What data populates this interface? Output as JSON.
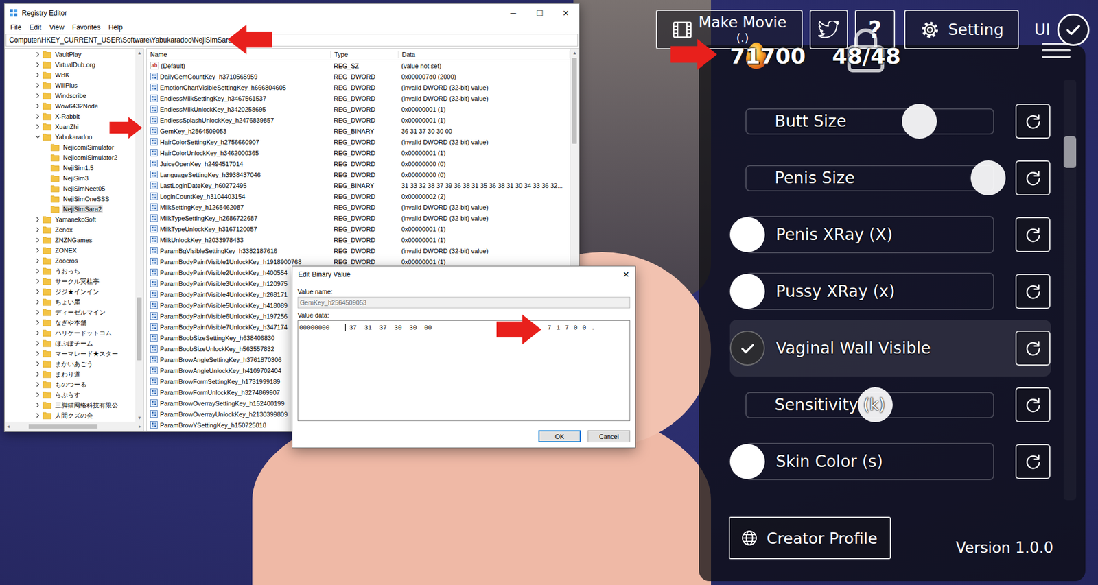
{
  "registry": {
    "title": "Registry Editor",
    "window_controls": [
      "─",
      "☐",
      "✕"
    ],
    "menu": [
      "File",
      "Edit",
      "View",
      "Favorites",
      "Help"
    ],
    "address": "Computer\\HKEY_CURRENT_USER\\Software\\Yabukaradoo\\NejiSimSara2",
    "tree": [
      {
        "label": "VaultPlay",
        "child": false,
        "expanded": false,
        "selected": false
      },
      {
        "label": "VirtualDub.org",
        "child": false,
        "expanded": false,
        "selected": false
      },
      {
        "label": "WBK",
        "child": false,
        "expanded": false,
        "selected": false
      },
      {
        "label": "WillPlus",
        "child": false,
        "expanded": false,
        "selected": false
      },
      {
        "label": "Windscribe",
        "child": false,
        "expanded": false,
        "selected": false
      },
      {
        "label": "Wow6432Node",
        "child": false,
        "expanded": false,
        "selected": false
      },
      {
        "label": "X-Rabbit",
        "child": false,
        "expanded": false,
        "selected": false
      },
      {
        "label": "XuanZhi",
        "child": false,
        "expanded": false,
        "selected": false
      },
      {
        "label": "Yabukaradoo",
        "child": false,
        "expanded": true,
        "selected": false
      },
      {
        "label": "NejicomiSimulator",
        "child": true,
        "expanded": false,
        "selected": false
      },
      {
        "label": "NejicomiSimulator2",
        "child": true,
        "expanded": false,
        "selected": false
      },
      {
        "label": "NejiSim1.5",
        "child": true,
        "expanded": false,
        "selected": false
      },
      {
        "label": "NejiSim3",
        "child": true,
        "expanded": false,
        "selected": false
      },
      {
        "label": "NejiSimNeet05",
        "child": true,
        "expanded": false,
        "selected": false
      },
      {
        "label": "NejiSimOneSSS",
        "child": true,
        "expanded": false,
        "selected": false
      },
      {
        "label": "NejiSimSara2",
        "child": true,
        "expanded": false,
        "selected": true
      },
      {
        "label": "YamanekoSoft",
        "child": false,
        "expanded": false,
        "selected": false
      },
      {
        "label": "Zenox",
        "child": false,
        "expanded": false,
        "selected": false
      },
      {
        "label": "ZNZNGames",
        "child": false,
        "expanded": false,
        "selected": false
      },
      {
        "label": "ZONEX",
        "child": false,
        "expanded": false,
        "selected": false
      },
      {
        "label": "Zoocros",
        "child": false,
        "expanded": false,
        "selected": false
      },
      {
        "label": "うおっち",
        "child": false,
        "expanded": false,
        "selected": false
      },
      {
        "label": "サークル冥柱亭",
        "child": false,
        "expanded": false,
        "selected": false
      },
      {
        "label": "ジジ★インイン",
        "child": false,
        "expanded": false,
        "selected": false
      },
      {
        "label": "ちょい屋",
        "child": false,
        "expanded": false,
        "selected": false
      },
      {
        "label": "ディーゼルマイン",
        "child": false,
        "expanded": false,
        "selected": false
      },
      {
        "label": "なぎや本舗",
        "child": false,
        "expanded": false,
        "selected": false
      },
      {
        "label": "ハリケードットコム",
        "child": false,
        "expanded": false,
        "selected": false
      },
      {
        "label": "ほぷぽチーム",
        "child": false,
        "expanded": false,
        "selected": false
      },
      {
        "label": "マーマレード★スター",
        "child": false,
        "expanded": false,
        "selected": false
      },
      {
        "label": "まかいあごう",
        "child": false,
        "expanded": false,
        "selected": false
      },
      {
        "label": "まわり道",
        "child": false,
        "expanded": false,
        "selected": false
      },
      {
        "label": "ものつーる",
        "child": false,
        "expanded": false,
        "selected": false
      },
      {
        "label": "らぷらす",
        "child": false,
        "expanded": false,
        "selected": false
      },
      {
        "label": "三脚猫网络科技有限公",
        "child": false,
        "expanded": false,
        "selected": false
      },
      {
        "label": "人間クズの会",
        "child": false,
        "expanded": false,
        "selected": false
      }
    ],
    "columns": [
      "Name",
      "Type",
      "Data"
    ],
    "string_icon_text": "ab",
    "rows": [
      {
        "kind": "string",
        "name": "(Default)",
        "type": "REG_SZ",
        "data": "(value not set)"
      },
      {
        "kind": "binary",
        "name": "DailyGemCountKey_h3710565959",
        "type": "REG_DWORD",
        "data": "0x000007d0 (2000)"
      },
      {
        "kind": "binary",
        "name": "EmotionChartVisibleSettingKey_h666804605",
        "type": "REG_DWORD",
        "data": "(invalid DWORD (32-bit) value)"
      },
      {
        "kind": "binary",
        "name": "EndlessMilkSettingKey_h3467561537",
        "type": "REG_DWORD",
        "data": "(invalid DWORD (32-bit) value)"
      },
      {
        "kind": "binary",
        "name": "EndlessMilkUnlockKey_h3420258695",
        "type": "REG_DWORD",
        "data": "0x00000001 (1)"
      },
      {
        "kind": "binary",
        "name": "EndlessSplashUnlockKey_h2476839857",
        "type": "REG_DWORD",
        "data": "0x00000001 (1)"
      },
      {
        "kind": "binary",
        "name": "GemKey_h2564509053",
        "type": "REG_BINARY",
        "data": "36 31 37 30 30 00"
      },
      {
        "kind": "binary",
        "name": "HairColorSettingKey_h2756660907",
        "type": "REG_DWORD",
        "data": "(invalid DWORD (32-bit) value)"
      },
      {
        "kind": "binary",
        "name": "HairColorUnlockKey_h3462000365",
        "type": "REG_DWORD",
        "data": "0x00000001 (1)"
      },
      {
        "kind": "binary",
        "name": "JuiceOpenKey_h2494517014",
        "type": "REG_DWORD",
        "data": "0x00000000 (0)"
      },
      {
        "kind": "binary",
        "name": "LanguageSettingKey_h3938437046",
        "type": "REG_DWORD",
        "data": "0x00000000 (0)"
      },
      {
        "kind": "binary",
        "name": "LastLoginDateKey_h60272495",
        "type": "REG_BINARY",
        "data": "31 33 32 38 37 39 36 38 31 35 36 38 31 30 34 33 36 32..."
      },
      {
        "kind": "binary",
        "name": "LoginCountKey_h3104403154",
        "type": "REG_DWORD",
        "data": "0x00000002 (2)"
      },
      {
        "kind": "binary",
        "name": "MilkSettingKey_h1265462087",
        "type": "REG_DWORD",
        "data": "(invalid DWORD (32-bit) value)"
      },
      {
        "kind": "binary",
        "name": "MilkTypeSettingKey_h2686722687",
        "type": "REG_DWORD",
        "data": "(invalid DWORD (32-bit) value)"
      },
      {
        "kind": "binary",
        "name": "MilkTypeUnlockKey_h3167120057",
        "type": "REG_DWORD",
        "data": "0x00000001 (1)"
      },
      {
        "kind": "binary",
        "name": "MilkUnlockKey_h2033978433",
        "type": "REG_DWORD",
        "data": "0x00000001 (1)"
      },
      {
        "kind": "binary",
        "name": "ParamBgVisibleSettingKey_h3382187616",
        "type": "REG_DWORD",
        "data": "(invalid DWORD (32-bit) value)"
      },
      {
        "kind": "binary",
        "name": "ParamBodyPaintVisible1UnlockKey_h1918900768",
        "type": "REG_DWORD",
        "data": "0x00000001 (1)"
      },
      {
        "kind": "binary",
        "name": "ParamBodyPaintVisible2UnlockKey_h400554",
        "type": "",
        "data": ""
      },
      {
        "kind": "binary",
        "name": "ParamBodyPaintVisible3UnlockKey_h120975",
        "type": "",
        "data": ""
      },
      {
        "kind": "binary",
        "name": "ParamBodyPaintVisible4UnlockKey_h268171",
        "type": "",
        "data": ""
      },
      {
        "kind": "binary",
        "name": "ParamBodyPaintVisible5UnlockKey_h418089",
        "type": "",
        "data": ""
      },
      {
        "kind": "binary",
        "name": "ParamBodyPaintVisible6UnlockKey_h197256",
        "type": "",
        "data": ""
      },
      {
        "kind": "binary",
        "name": "ParamBodyPaintVisible7UnlockKey_h347174",
        "type": "",
        "data": ""
      },
      {
        "kind": "binary",
        "name": "ParamBoobSizeSettingKey_h638406830",
        "type": "",
        "data": ""
      },
      {
        "kind": "binary",
        "name": "ParamBoobSizeUnlockKey_h563557832",
        "type": "",
        "data": ""
      },
      {
        "kind": "binary",
        "name": "ParamBrowAngleSettingKey_h3761870306",
        "type": "",
        "data": ""
      },
      {
        "kind": "binary",
        "name": "ParamBrowAngleUnlockKey_h4109702404",
        "type": "",
        "data": ""
      },
      {
        "kind": "binary",
        "name": "ParamBrowFormSettingKey_h1731999189",
        "type": "",
        "data": ""
      },
      {
        "kind": "binary",
        "name": "ParamBrowFormUnlockKey_h3274869907",
        "type": "",
        "data": ""
      },
      {
        "kind": "binary",
        "name": "ParamBrowOverraySettingKey_h152400199",
        "type": "",
        "data": ""
      },
      {
        "kind": "binary",
        "name": "ParamBrowOverrayUnlockKey_h2130399809",
        "type": "",
        "data": ""
      },
      {
        "kind": "binary",
        "name": "ParamBrowYSettingKey_h150725818",
        "type": "",
        "data": ""
      }
    ]
  },
  "dialog": {
    "title": "Edit Binary Value",
    "close": "✕",
    "value_name_label": "Value name:",
    "value_name": "GemKey_h2564509053",
    "value_data_label": "Value data:",
    "offset": "00000000",
    "bytes": [
      "37",
      "31",
      "37",
      "30",
      "30",
      "00"
    ],
    "ascii": "7 1 7 0 0 .",
    "buttons": [
      {
        "label": "OK",
        "selected": true
      },
      {
        "label": "Cancel",
        "selected": false
      }
    ]
  },
  "game": {
    "make_movie": {
      "label": "Make Movie",
      "shortcut": "(.)"
    },
    "help_label": "?",
    "setting_label": "Setting",
    "ui_label": "UI",
    "ui_checked": true,
    "gems": "71700",
    "slots": "48/48",
    "settings": [
      {
        "kind": "slider",
        "label": "Butt Size",
        "level": 0.7
      },
      {
        "kind": "slider",
        "label": "Penis Size",
        "level": 0.98
      },
      {
        "kind": "toggle",
        "label": "Penis XRay (X)",
        "checked": false
      },
      {
        "kind": "toggle",
        "label": "Pussy XRay (x)",
        "checked": false
      },
      {
        "kind": "toggle",
        "label": "Vaginal Wall Visible",
        "checked": true
      },
      {
        "kind": "slider",
        "label": "Sensitivity (k)",
        "level": 0.52
      },
      {
        "kind": "toggle",
        "label": "Skin Color (s)",
        "checked": false
      }
    ],
    "creator_profile": "Creator Profile",
    "version": "Version 1.0.0"
  }
}
